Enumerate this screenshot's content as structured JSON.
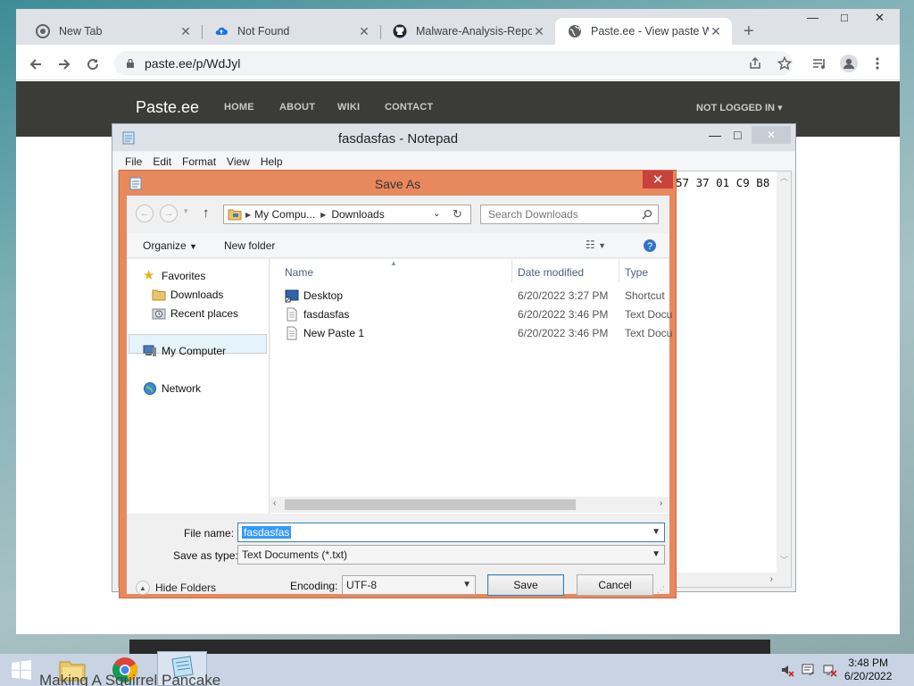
{
  "browser": {
    "tabs": [
      {
        "title": "New Tab",
        "favicon": "chrome-icon"
      },
      {
        "title": "Not Found",
        "favicon": "cloud-icon"
      },
      {
        "title": "Malware-Analysis-Report",
        "favicon": "github-icon"
      },
      {
        "title": "Paste.ee - View paste Wd",
        "favicon": "globe-icon",
        "active": true
      }
    ],
    "url": "paste.ee/p/WdJyl"
  },
  "site": {
    "brand": "Paste.ee",
    "nav": [
      "HOME",
      "ABOUT",
      "WIKI",
      "CONTACT"
    ],
    "account": "NOT LOGGED IN"
  },
  "notepad": {
    "title": "fasdasfas - Notepad",
    "menu": [
      "File",
      "Edit",
      "Format",
      "View",
      "Help"
    ],
    "content": "57 37 01 C9 B8"
  },
  "save_dialog": {
    "title": "Save As",
    "breadcrumb": [
      "My Compu...",
      "Downloads"
    ],
    "search_placeholder": "Search Downloads",
    "organize_label": "Organize",
    "new_folder_label": "New folder",
    "nav": {
      "favorites": "Favorites",
      "downloads": "Downloads",
      "recent": "Recent places",
      "computer": "My Computer",
      "network": "Network"
    },
    "columns": {
      "name": "Name",
      "date": "Date modified",
      "type": "Type"
    },
    "files": [
      {
        "name": "Desktop",
        "date": "6/20/2022 3:27 PM",
        "type": "Shortcut",
        "icon": "desktop-shortcut-icon"
      },
      {
        "name": "fasdasfas",
        "date": "6/20/2022 3:46 PM",
        "type": "Text Docu",
        "icon": "text-document-icon"
      },
      {
        "name": "New Paste 1",
        "date": "6/20/2022 3:46 PM",
        "type": "Text Docu",
        "icon": "text-document-icon"
      }
    ],
    "file_name_label": "File name:",
    "file_name_value": "fasdasfas",
    "save_type_label": "Save as type:",
    "save_type_value": "Text Documents (*.txt)",
    "hide_folders_label": "Hide Folders",
    "encoding_label": "Encoding:",
    "encoding_value": "UTF-8",
    "save_label": "Save",
    "cancel_label": "Cancel"
  },
  "taskbar": {
    "peek_text": "Making A Squirrel Pancake",
    "time": "3:48 PM",
    "date": "6/20/2022"
  },
  "colors": {
    "dialog_frame": "#e8885d",
    "selection": "#3399ff",
    "site_nav": "#3b3b38",
    "close_red": "#c9413b"
  }
}
